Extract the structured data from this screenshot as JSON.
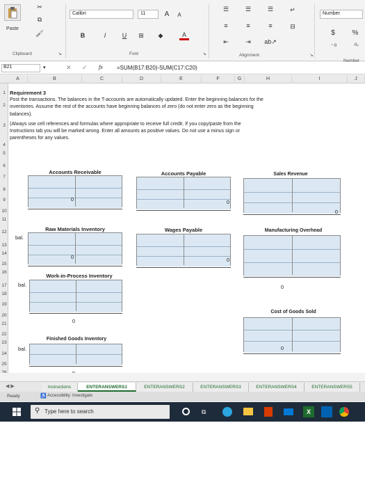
{
  "ribbon": {
    "paste_label": "Paste",
    "font_name": "Calibri",
    "font_size": "11",
    "font_grow": "A",
    "font_shrink": "A",
    "bold": "B",
    "italic": "I",
    "underline": "U",
    "font_color": "A",
    "number_format": "Number",
    "currency_symbol": "$",
    "percent_symbol": "%",
    "group_clipboard": "Clipboard",
    "group_font": "Font",
    "group_alignment": "Alignment",
    "group_number": "Number"
  },
  "formula_bar": {
    "name_box": "B21",
    "fx": "fx",
    "formula": "=SUM(B17:B20)-SUM(C17:C20)"
  },
  "columns": [
    "A",
    "B",
    "C",
    "D",
    "E",
    "F",
    "G",
    "H",
    "I",
    "J"
  ],
  "rows": [
    "1",
    "2",
    "3",
    "4",
    "5",
    "6",
    "7",
    "8",
    "9",
    "10",
    "11",
    "12",
    "13",
    "14",
    "15",
    "16",
    "17",
    "18",
    "19",
    "20",
    "21",
    "22",
    "23",
    "24",
    "25",
    "26",
    "27"
  ],
  "instructions": {
    "title": "Requirement 3",
    "line1": "Post the transactions. The balances in the T-accounts are automatically updated. Enter the beginning balances for the",
    "line2": "inventories. Assume the rest of the accounts have beginning balances of zero (do not enter zero as the beginning",
    "line3": "balances).",
    "line4": "(Always use cell references and formulas where appropriate to receive full credit. If you copy/paste from the",
    "line5": "Instructions tab you will be marked wrong. Enter all amounts as positive values. Do not use a minus sign or",
    "line6": "parentheses for any values."
  },
  "accounts": {
    "accounts_receivable": {
      "title": "Accounts Receivable",
      "balance": "0"
    },
    "accounts_payable": {
      "title": "Accounts Payable",
      "balance": "0"
    },
    "sales_revenue": {
      "title": "Sales Revenue",
      "balance": "0"
    },
    "raw_materials": {
      "title": "Raw Materials Inventory",
      "balance": "0",
      "row_label": "bal."
    },
    "wages_payable": {
      "title": "Wages Payable",
      "balance": "0"
    },
    "manufacturing_overhead": {
      "title": "Manufacturing Overhead",
      "balance": "0"
    },
    "wip": {
      "title": "Work-in-Process Inventory",
      "balance": "0",
      "row_label": "bal."
    },
    "cogs": {
      "title": "Cost of Goods Sold",
      "balance": "0"
    },
    "finished_goods": {
      "title": "Finished Goods Inventory",
      "balance": "0",
      "row_label": "bal."
    }
  },
  "sheet_tabs": [
    "Instructions",
    "ENTERANSWERS1",
    "ENTERANSWERS2",
    "ENTERANSWERS3",
    "ENTERANSWERS4",
    "ENTERANSWERS5"
  ],
  "status": {
    "ready": "Ready",
    "accessibility": "Accessibility: Investigate"
  },
  "taskbar": {
    "search_placeholder": "Type here to search"
  },
  "colors": {
    "accent": "#1d6b2d",
    "tacct_fill": "#d9e7f3",
    "taskbar": "#1e2b3a"
  }
}
